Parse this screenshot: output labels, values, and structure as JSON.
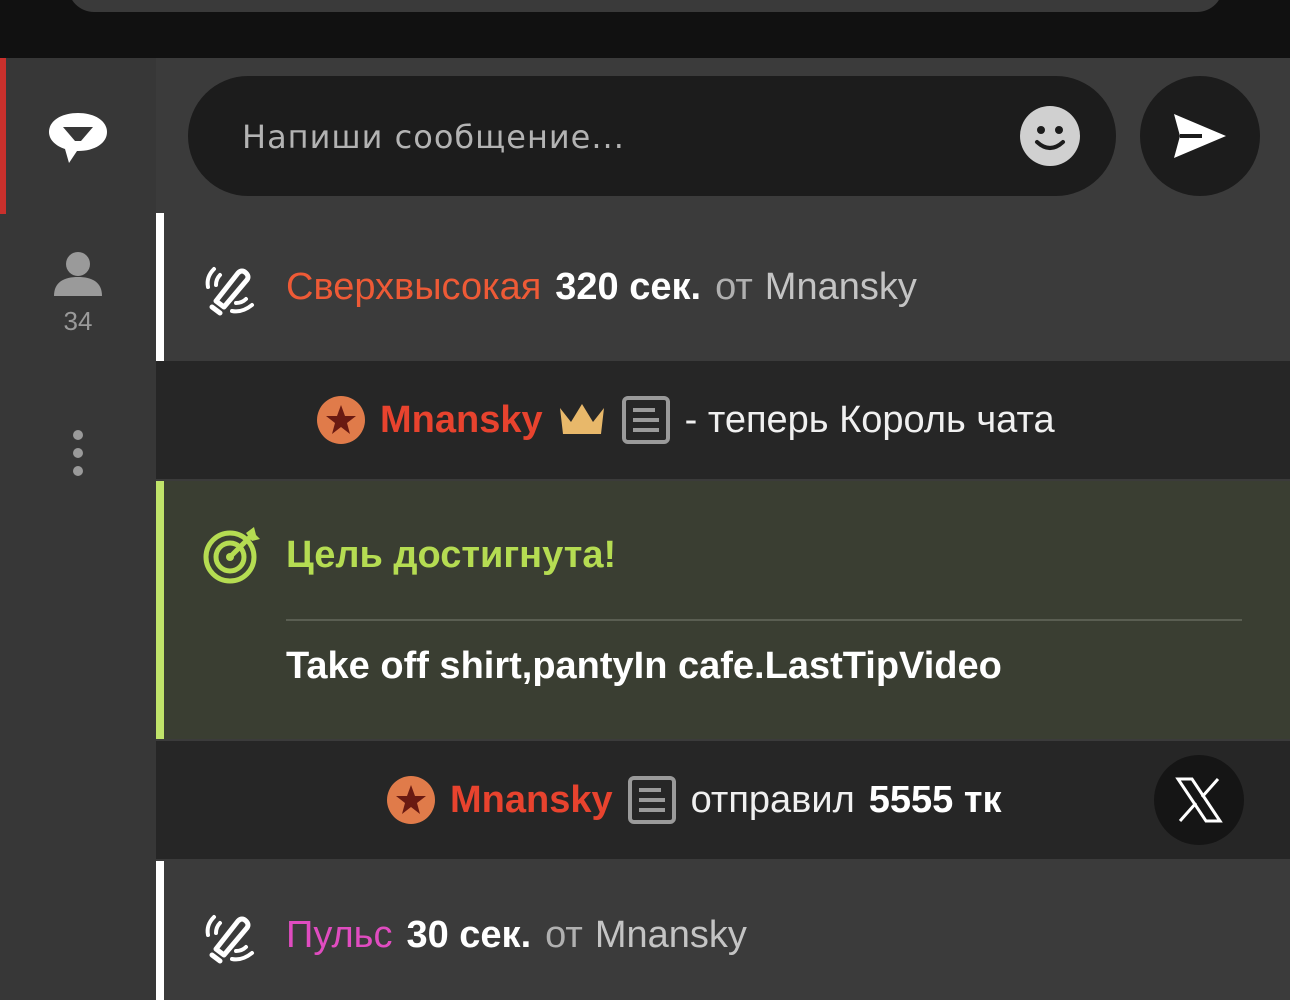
{
  "composer": {
    "placeholder": "Напиши сообщение..."
  },
  "sidebar": {
    "users_count": "34"
  },
  "messages": {
    "lovense1": {
      "level": "Сверхвысокая",
      "duration": "320 сек.",
      "from": "от",
      "user": "Mnansky"
    },
    "king": {
      "user": "Mnansky",
      "text": "- теперь Король чата"
    },
    "goal": {
      "title": "Цель достигнута!",
      "text": "Take off shirt,pantyIn cafe.LastTipVideo"
    },
    "tip": {
      "user": "Mnansky",
      "action": "отправил",
      "amount": "5555 тк"
    },
    "lovense2": {
      "level": "Пульс",
      "duration": "30 сек.",
      "from": "от",
      "user": "Mnansky"
    }
  },
  "icons": {
    "chat": "chat-bubble-icon",
    "users": "user-icon",
    "more": "more-vertical-icon",
    "emoji": "smiley-icon",
    "send": "send-icon",
    "vibe": "vibration-icon",
    "badge": "star-badge-icon",
    "crown": "crown-icon",
    "profile": "document-icon",
    "goal": "target-icon",
    "close": "x-logo-icon"
  },
  "colors": {
    "accent": "#c9302c",
    "goal": "#b5dc52",
    "username": "#e8432e",
    "level_high": "#ee5a36",
    "level_pulse": "#e04cc0"
  }
}
